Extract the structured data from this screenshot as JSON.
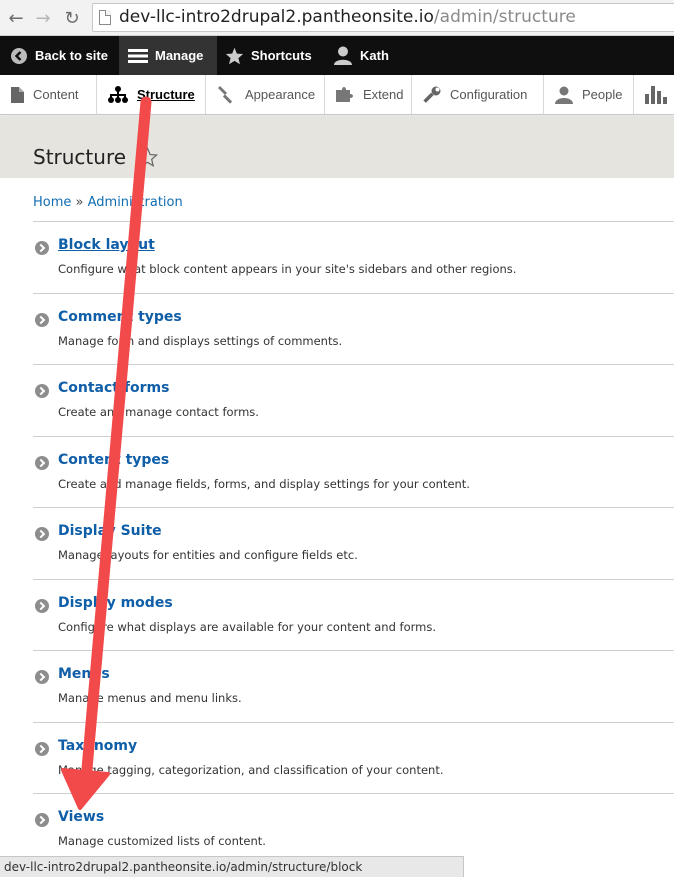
{
  "browser": {
    "url_host": "dev-llc-intro2drupal2.pantheonsite.io",
    "url_path": "/admin/structure",
    "status_url": "dev-llc-intro2drupal2.pantheonsite.io/admin/structure/block"
  },
  "toolbar": {
    "back_label": "Back to site",
    "manage_label": "Manage",
    "shortcuts_label": "Shortcuts",
    "user_label": "Kath"
  },
  "tray": {
    "content": "Content",
    "structure": "Structure",
    "appearance": "Appearance",
    "extend": "Extend",
    "configuration": "Configuration",
    "people": "People"
  },
  "page": {
    "title": "Structure"
  },
  "breadcrumb": {
    "home": "Home",
    "separator": " » ",
    "admin": "Administration"
  },
  "items": [
    {
      "title": "Block layout",
      "description": "Configure what block content appears in your site's sidebars and other regions."
    },
    {
      "title": "Comment types",
      "description": "Manage form and displays settings of comments."
    },
    {
      "title": "Contact forms",
      "description": "Create and manage contact forms."
    },
    {
      "title": "Content types",
      "description": "Create and manage fields, forms, and display settings for your content."
    },
    {
      "title": "Display Suite",
      "description": "Manage layouts for entities and configure fields etc."
    },
    {
      "title": "Display modes",
      "description": "Configure what displays are available for your content and forms."
    },
    {
      "title": "Menus",
      "description": "Manage menus and menu links."
    },
    {
      "title": "Taxonomy",
      "description": "Manage tagging, categorization, and classification of your content."
    },
    {
      "title": "Views",
      "description": "Manage customized lists of content."
    }
  ],
  "colors": {
    "link": "#0f5ea8",
    "toolbar_bg": "#0f0f0f",
    "annotation_arrow": "#f24a4a"
  }
}
